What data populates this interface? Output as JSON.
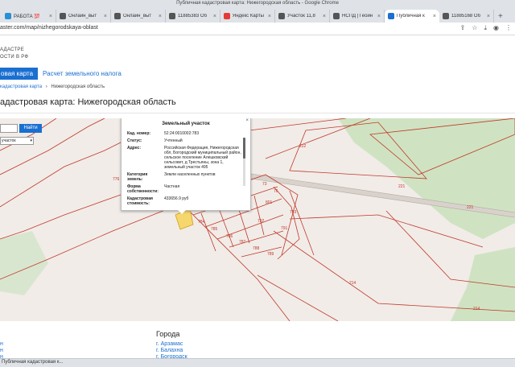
{
  "window_title": "Публичная кадастровая карта: Нижегородская область - Google Chrome",
  "tabs": [
    {
      "label": "РАБОТА 💯",
      "color": "#2a8fd8"
    },
    {
      "label": "Онлайн_выт",
      "color": "#555555"
    },
    {
      "label": "Онлайн_выт",
      "color": "#555555"
    },
    {
      "label": "11885383 Об",
      "color": "#555555"
    },
    {
      "label": "Яндекс Карты",
      "color": "#e53935"
    },
    {
      "label": "Участок 11,8",
      "color": "#555555"
    },
    {
      "label": "НСПД | Геоин",
      "color": "#555555"
    },
    {
      "label": "Публичная к",
      "color": "#1a6fd1",
      "active": true
    },
    {
      "label": "11885168 Об",
      "color": "#555555"
    }
  ],
  "url": "aster.com/map/nizhegorodskaya-oblast",
  "logo_lines": [
    "АДАСТРЕ",
    "ОСТИ В РФ"
  ],
  "nav": {
    "active": "овая карта",
    "link": "Расчет земельного налога"
  },
  "breadcrumb": {
    "link": "кадастровая карта",
    "sep": "›",
    "current": "Нижегородская область"
  },
  "page_title": "адастровая карта: Нижегородская область",
  "map": {
    "search_button": "Найти",
    "layer_select": "участок",
    "parcel_labels": [
      "222",
      "221",
      "221",
      "214",
      "214",
      "801",
      "792",
      "784",
      "785",
      "786",
      "787",
      "788",
      "789",
      "791",
      "793",
      "776",
      "73",
      "76"
    ],
    "popup": {
      "title": "Земельный участок",
      "rows": [
        {
          "key": "Кад. номер:",
          "value": "52:24:0010002:783"
        },
        {
          "key": "Статус:",
          "value": "Учтенный"
        },
        {
          "key": "Адрес:",
          "value": "Российская Федерация, Нижегородская обл, Богородский муниципальный район, сельское поселение Алешковский сельсовет, д Трестьяны, зона 1, земельный участок 495"
        },
        {
          "key": "Категория земель:",
          "value": "Земли населенных пунктов"
        },
        {
          "key": "Форма собственности:",
          "value": "Частная"
        },
        {
          "key": "Кадастровая стоимость:",
          "value": "433656.9 руб"
        }
      ]
    }
  },
  "footer": {
    "cities_title": "Города",
    "cities": [
      "г. Арзамас",
      "г. Балахна",
      "г. Богородск"
    ],
    "left_items": [
      "н",
      "н",
      "н"
    ]
  },
  "download_item": "Публичная кадастровая к...",
  "colors": {
    "accent": "#1a6fd1",
    "parcel_line": "#c0392b",
    "forest": "#cfe3c2",
    "map_bg": "#f1ece8",
    "highlight": "#f5d76e"
  }
}
